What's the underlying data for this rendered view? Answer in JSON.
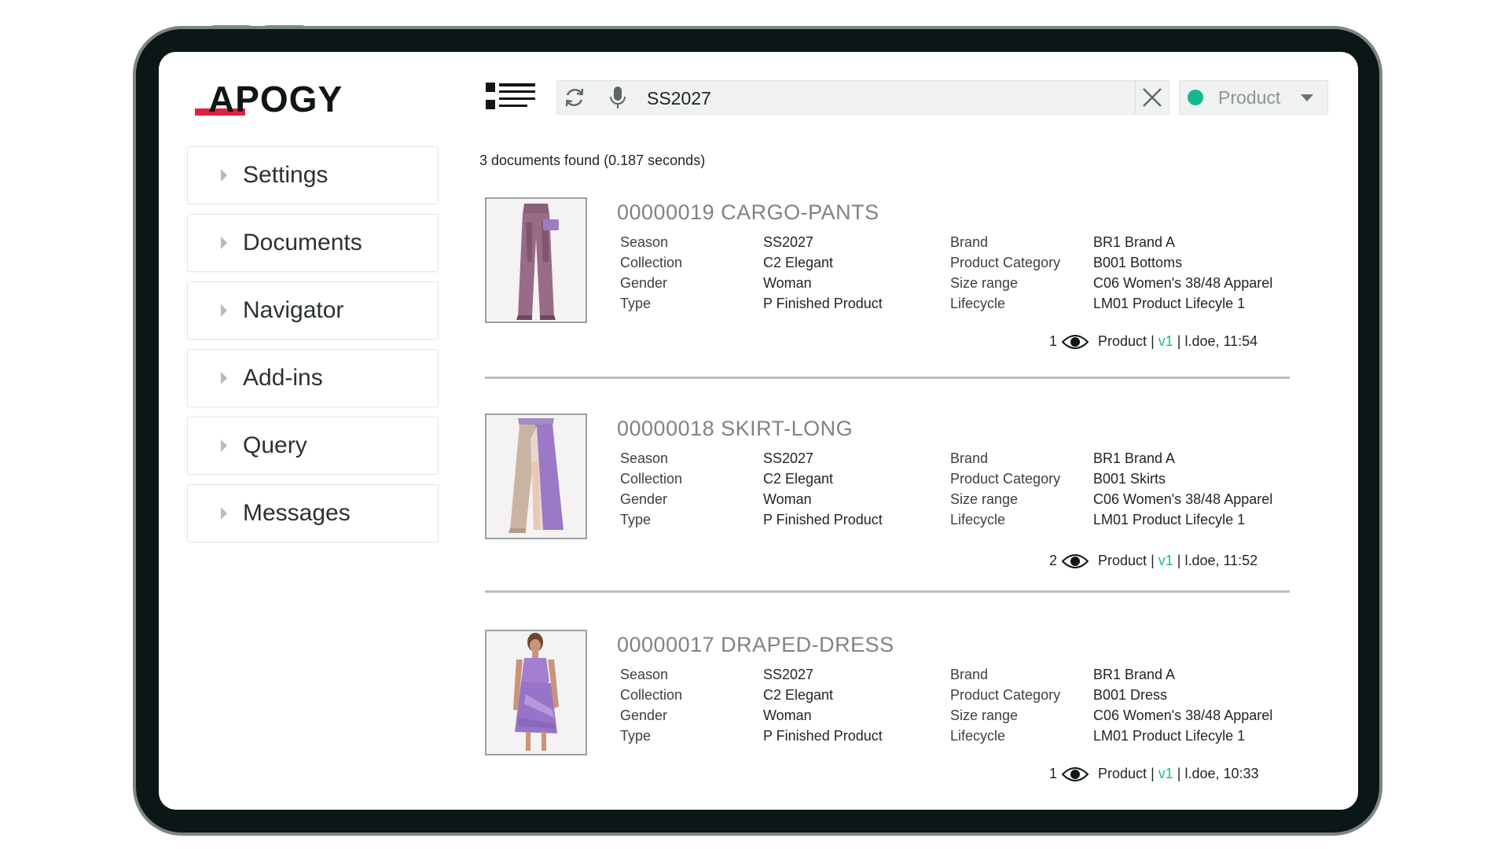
{
  "brand": {
    "logo_text": "APOGY",
    "accent": "#e0223d"
  },
  "sidebar": {
    "items": [
      {
        "label": "Settings"
      },
      {
        "label": "Documents"
      },
      {
        "label": "Navigator"
      },
      {
        "label": "Add-ins"
      },
      {
        "label": "Query"
      },
      {
        "label": "Messages"
      }
    ]
  },
  "search": {
    "value": "SS2027",
    "placeholder": ""
  },
  "type_select": {
    "value": "Product",
    "dot_color": "#14b890"
  },
  "results_count": "3 documents found (0.187 seconds)",
  "attr_labels": {
    "season": "Season",
    "collection": "Collection",
    "gender": "Gender",
    "type": "Type",
    "brand": "Brand",
    "product_category": "Product Category",
    "size_range": "Size range",
    "lifecycle": "Lifecycle"
  },
  "results": [
    {
      "title": "00000019 CARGO-PANTS",
      "season": "SS2027",
      "collection": "C2 Elegant",
      "gender": "Woman",
      "type": "P Finished Product",
      "brand": "BR1 Brand A",
      "product_category": "B001 Bottoms",
      "size_range": "C06 Women's 38/48 Apparel",
      "lifecycle": "LM01 Product Lifecyle 1",
      "views": "1",
      "doc_type": "Product",
      "version": "v1",
      "user_time": "l.doe, 11:54",
      "image": "cargo-pants"
    },
    {
      "title": "00000018 SKIRT-LONG",
      "season": "SS2027",
      "collection": "C2 Elegant",
      "gender": "Woman",
      "type": "P Finished Product",
      "brand": "BR1 Brand A",
      "product_category": "B001 Skirts",
      "size_range": "C06 Women's 38/48 Apparel",
      "lifecycle": "LM01 Product Lifecyle 1",
      "views": "2",
      "doc_type": "Product",
      "version": "v1",
      "user_time": "l.doe, 11:52",
      "image": "skirt-long"
    },
    {
      "title": "00000017 DRAPED-DRESS",
      "season": "SS2027",
      "collection": "C2 Elegant",
      "gender": "Woman",
      "type": "P Finished Product",
      "brand": "BR1 Brand A",
      "product_category": "B001 Dress",
      "size_range": "C06 Women's 38/48 Apparel",
      "lifecycle": "LM01 Product Lifecyle 1",
      "views": "1",
      "doc_type": "Product",
      "version": "v1",
      "user_time": "l.doe, 10:33",
      "image": "draped-dress"
    }
  ]
}
